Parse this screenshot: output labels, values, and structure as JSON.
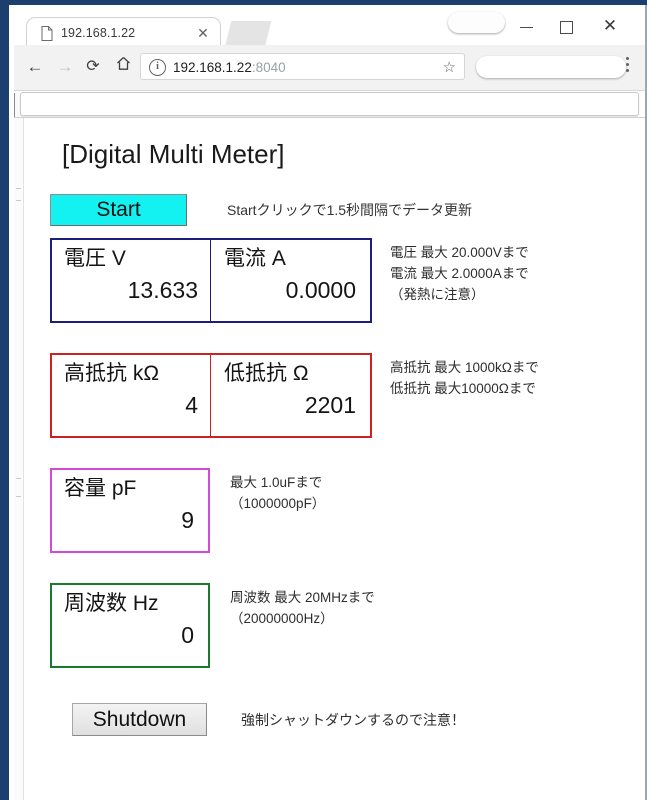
{
  "browser": {
    "tab": {
      "title": "192.168.1.22",
      "favicon_name": "page-icon",
      "close_label": "✕"
    },
    "toolbar": {
      "back_label": "←",
      "forward_label": "→",
      "reload_label": "⟳",
      "home_label": "⌂",
      "info_label": "i",
      "url_host": "192.168.1.22",
      "url_port": ":8040",
      "star_label": "☆",
      "menu_label": "kebab-menu"
    },
    "window_controls": {
      "minimize_label": "–",
      "maximize_label": "□",
      "close_label": "✕"
    }
  },
  "page": {
    "title": "[Digital Multi Meter]",
    "start_button": "Start",
    "start_note": "Startクリックで1.5秒間隔でデータ更新",
    "shutdown_button": "Shutdown",
    "shutdown_note": "強制シャットダウンするので注意！",
    "meters": {
      "voltage_current": {
        "border_color": "#1d1d7a",
        "cells": [
          {
            "label": "電圧 V",
            "value": "13.633"
          },
          {
            "label": "電流 A",
            "value": "0.0000"
          }
        ],
        "notes": [
          "電圧 最大 20.000Vまで",
          "電流 最大 2.0000Aまで",
          "（発熱に注意）"
        ]
      },
      "resistance": {
        "border_color": "#cc2222",
        "cells": [
          {
            "label": "高抵抗 kΩ",
            "value": "4"
          },
          {
            "label": "低抵抗 Ω",
            "value": "2201"
          }
        ],
        "notes": [
          "高抵抗 最大 1000kΩまで",
          "低抵抗 最大10000Ωまで"
        ]
      },
      "capacitance": {
        "border_color": "#d44ad4",
        "cells": [
          {
            "label": "容量 pF",
            "value": "9"
          }
        ],
        "notes": [
          "最大 1.0uFまで",
          "（1000000pF）"
        ]
      },
      "frequency": {
        "border_color": "#1a7a2e",
        "cells": [
          {
            "label": "周波数 Hz",
            "value": "0"
          }
        ],
        "notes": [
          "周波数 最大 20MHzまで",
          "（20000000Hz）"
        ]
      }
    }
  }
}
